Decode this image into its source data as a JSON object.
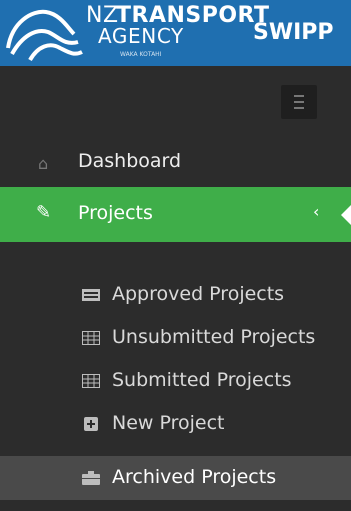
{
  "header": {
    "logo_nz": "NZ",
    "logo_transport": "TRANSPORT",
    "logo_agency": "AGENCY",
    "logo_subtitle": "WAKA KOTAHI",
    "app_name": "SWIPP"
  },
  "nav": {
    "dashboard_label": "Dashboard",
    "projects_label": "Projects",
    "projects_chevron": "‹",
    "sub_items": [
      {
        "label": "Approved Projects",
        "icon": "approved-list-icon"
      },
      {
        "label": "Unsubmitted Projects",
        "icon": "table-icon"
      },
      {
        "label": "Submitted Projects",
        "icon": "table-icon"
      },
      {
        "label": "New Project",
        "icon": "plus-square-icon"
      },
      {
        "label": "Archived Projects",
        "icon": "archive-icon"
      }
    ]
  },
  "colors": {
    "header": "#1f6fb0",
    "sidebar": "#2c2c2c",
    "active": "#3fae49",
    "selected_sub": "#4a4a4a"
  }
}
